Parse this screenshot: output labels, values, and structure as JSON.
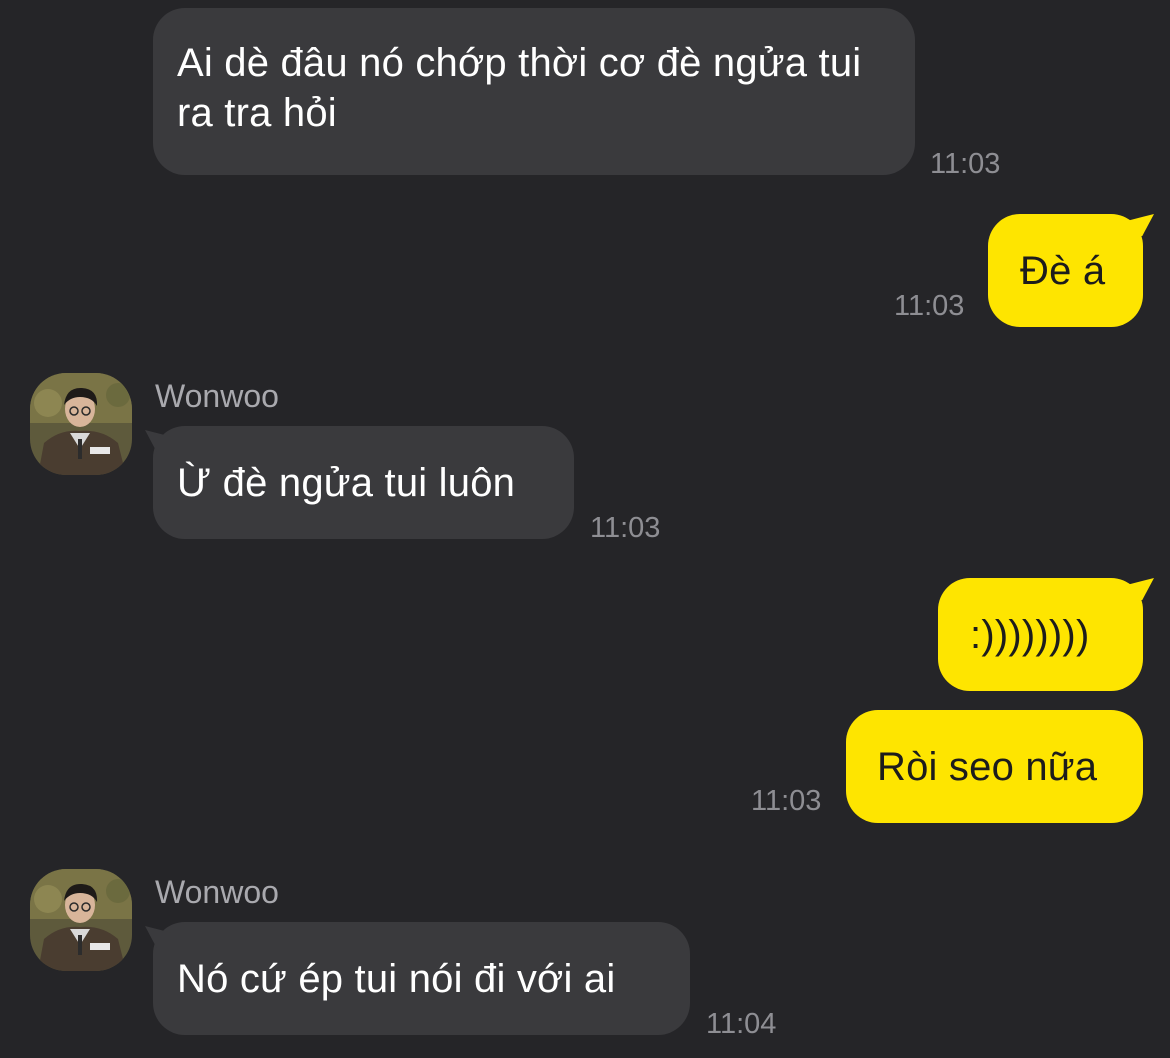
{
  "contact": {
    "name": "Wonwoo"
  },
  "messages": [
    {
      "direction": "in",
      "text": "Ai dè đâu nó chớp thời cơ đè ngửa tui ra tra hỏi",
      "time": "11:03"
    },
    {
      "direction": "out",
      "text": "Đè á",
      "time": "11:03"
    },
    {
      "direction": "in",
      "sender": "Wonwoo",
      "text": "Ừ đè ngửa tui luôn",
      "time": "11:03"
    },
    {
      "direction": "out",
      "text": ":))))))))",
      "time": ""
    },
    {
      "direction": "out",
      "text": "Ròi seo nữa",
      "time": "11:03"
    },
    {
      "direction": "in",
      "sender": "Wonwoo",
      "text": "Nó cứ ép tui nói đi với ai",
      "time": "11:04"
    }
  ],
  "colors": {
    "background": "#252528",
    "incoming_bubble": "#3a3a3d",
    "outgoing_bubble": "#fee500",
    "timestamp": "#8e8e93"
  },
  "icons": {
    "avatar": "contact-avatar-photo"
  }
}
